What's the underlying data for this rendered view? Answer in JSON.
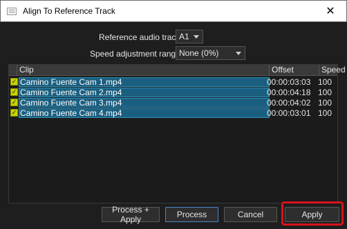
{
  "window": {
    "title": "Align To Reference Track",
    "close_glyph": "✕"
  },
  "form": {
    "reference_label": "Reference audio track",
    "reference_value": "A1",
    "speed_label": "Speed adjustment range",
    "speed_value": "None (0%)"
  },
  "table": {
    "columns": {
      "clip": "Clip",
      "offset": "Offset",
      "speed": "Speed"
    },
    "rows": [
      {
        "clip": "Camino Fuente Cam 1.mp4",
        "offset": "00:00:03:03",
        "speed": "100"
      },
      {
        "clip": "Camino Fuente Cam 2.mp4",
        "offset": "00:00:04:18",
        "speed": "100"
      },
      {
        "clip": "Camino Fuente Cam 3.mp4",
        "offset": "00:00:04:02",
        "speed": "100"
      },
      {
        "clip": "Camino Fuente Cam 4.mp4",
        "offset": "00:00:03:01",
        "speed": "100"
      }
    ]
  },
  "buttons": {
    "process_apply": "Process + Apply",
    "process": "Process",
    "cancel": "Cancel",
    "apply": "Apply"
  },
  "colors": {
    "selection": "#1b5f80",
    "checkbox": "#c8d400",
    "highlight": "#d9121c"
  }
}
